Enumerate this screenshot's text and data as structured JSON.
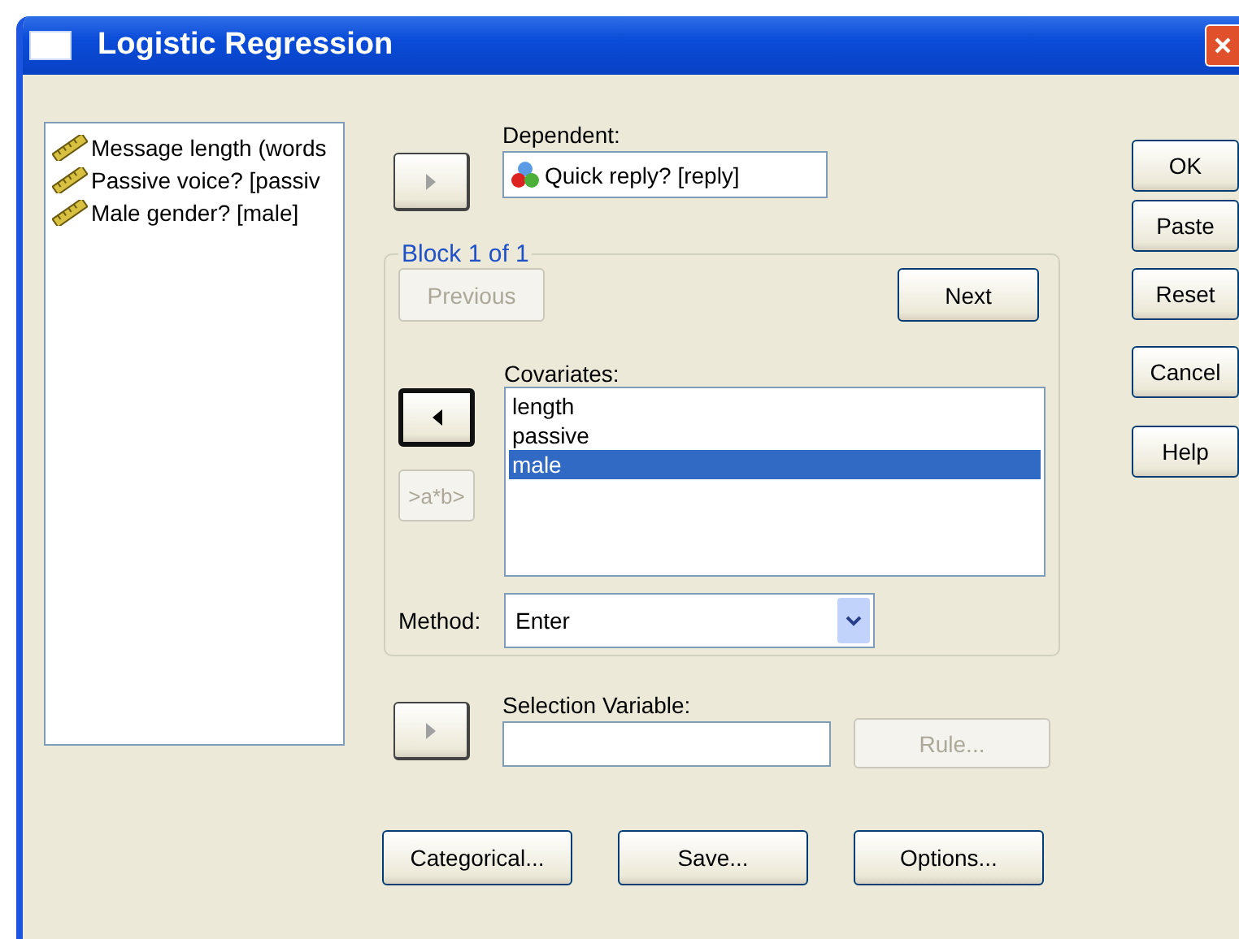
{
  "window": {
    "title": "Logistic Regression"
  },
  "variables": [
    {
      "label": "Message length (words"
    },
    {
      "label": "Passive voice? [passiv"
    },
    {
      "label": "Male gender? [male]"
    }
  ],
  "dependent": {
    "label": "Dependent:",
    "value": "Quick reply? [reply]"
  },
  "block": {
    "legend": "Block 1 of 1",
    "previous": {
      "label": "Previous",
      "disabled": true
    },
    "next": {
      "label": "Next",
      "disabled": false
    }
  },
  "covariates": {
    "label": "Covariates:",
    "items": [
      {
        "label": "length",
        "selected": false
      },
      {
        "label": "passive",
        "selected": false
      },
      {
        "label": "male",
        "selected": true
      }
    ],
    "interaction": {
      "label": ">a*b>",
      "disabled": true
    }
  },
  "method": {
    "label": "Method:",
    "value": "Enter"
  },
  "selection": {
    "label": "Selection Variable:",
    "rule": {
      "label": "Rule...",
      "disabled": true
    }
  },
  "bottom_buttons": [
    "Categorical...",
    "Save...",
    "Options..."
  ],
  "side_buttons": [
    "OK",
    "Paste",
    "Reset",
    "Cancel",
    "Help"
  ]
}
